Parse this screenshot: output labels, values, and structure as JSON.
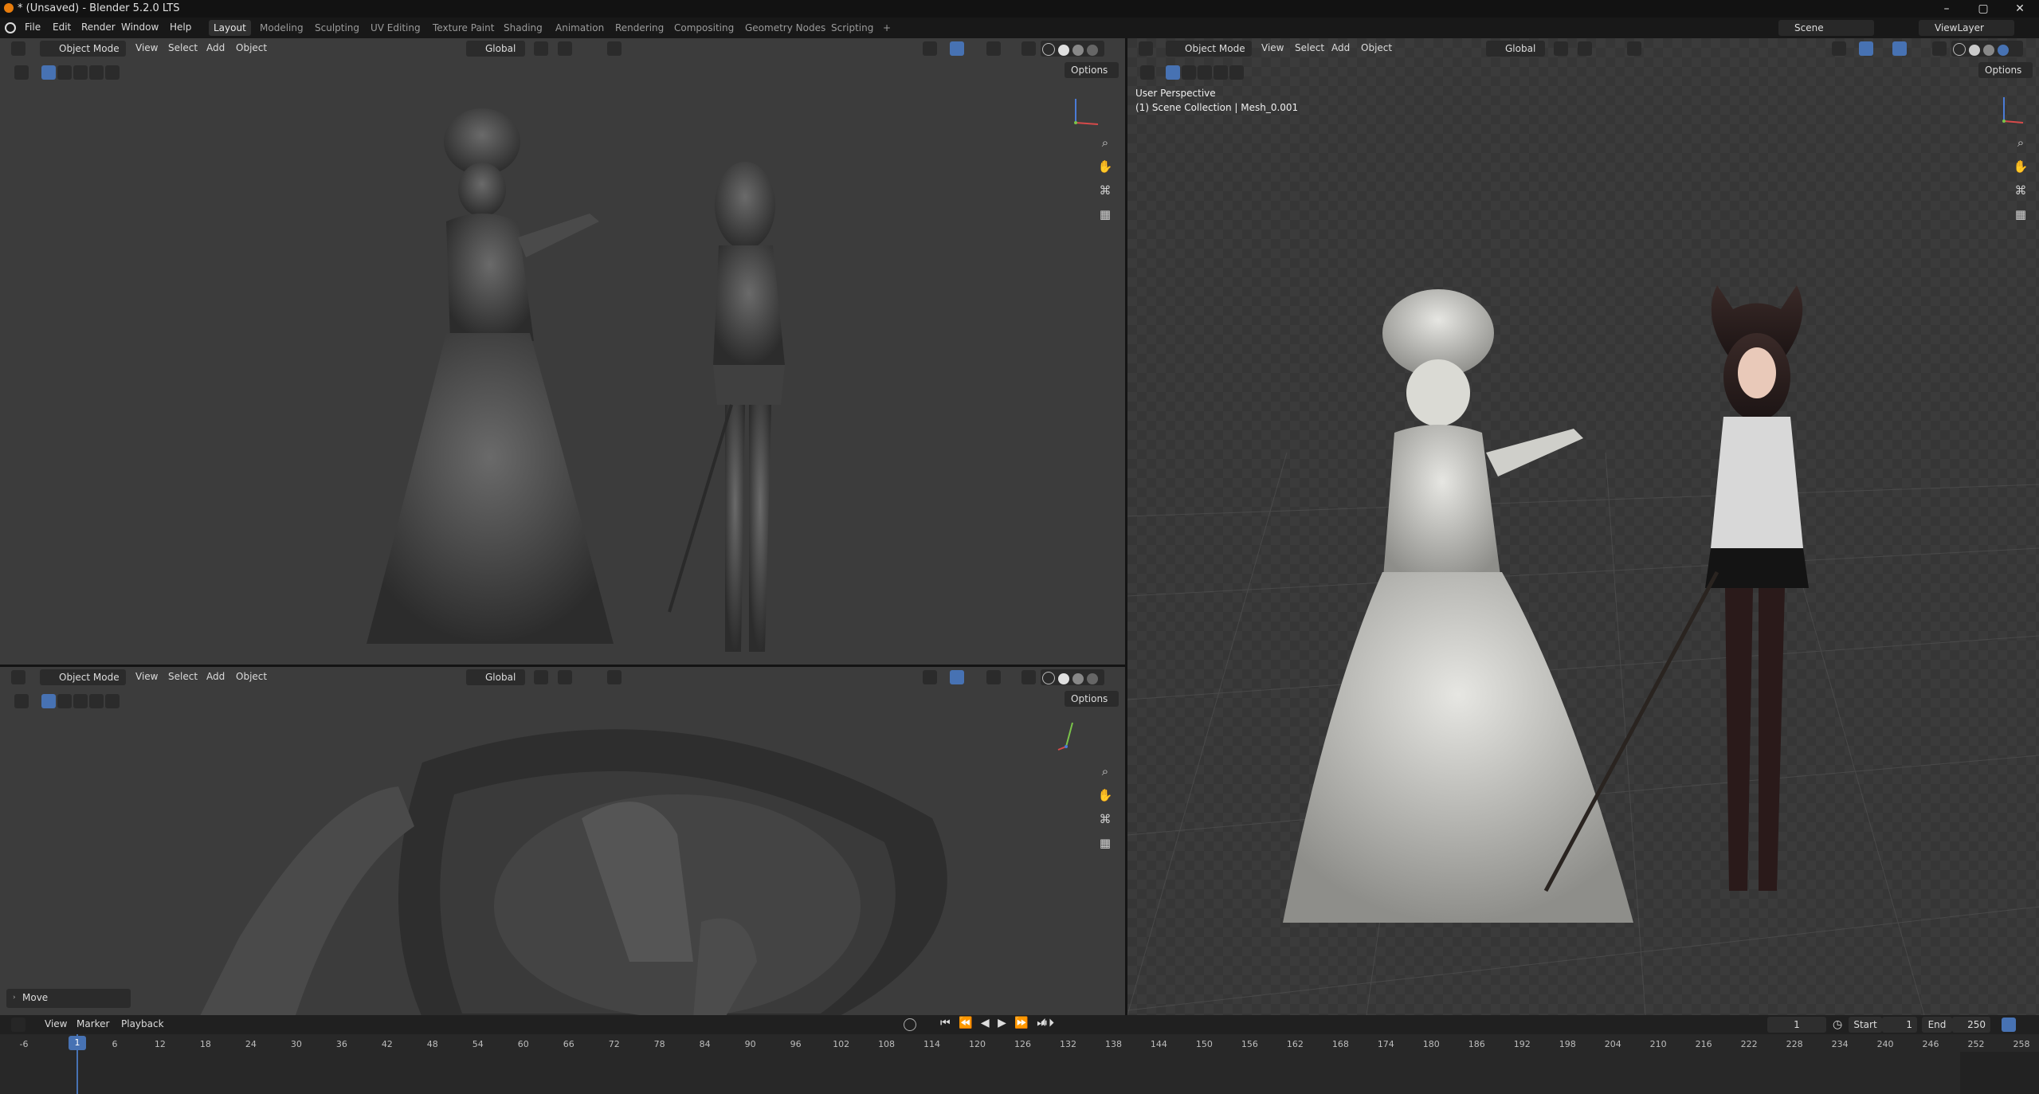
{
  "window": {
    "title": "* (Unsaved) - Blender 5.2.0 LTS",
    "controls": {
      "minimize": "–",
      "maximize": "▢",
      "close": "✕"
    }
  },
  "menu": [
    "File",
    "Edit",
    "Render",
    "Window",
    "Help"
  ],
  "workspaces": {
    "tabs": [
      "Layout",
      "Modeling",
      "Sculpting",
      "UV Editing",
      "Texture Paint",
      "Shading",
      "Animation",
      "Rendering",
      "Compositing",
      "Geometry Nodes",
      "Scripting"
    ],
    "active": "Layout",
    "add": "+"
  },
  "scene": {
    "label": "Scene",
    "view_layer": "ViewLayer"
  },
  "viewport_header": {
    "mode": "Object Mode",
    "menus": [
      "View",
      "Select",
      "Add",
      "Object"
    ],
    "orientation": "Global",
    "options": "Options"
  },
  "viewport_main": {
    "perspective": "User Perspective",
    "collection": "(1) Scene Collection | Mesh_0.001"
  },
  "viewport_bottom": {
    "operator_panel": "Move"
  },
  "timeline": {
    "menus": [
      "View",
      "Marker",
      "Playback"
    ],
    "current_frame": "1",
    "start_label": "Start",
    "start": "1",
    "end_label": "End",
    "end": "250",
    "ticks": [
      "-6",
      "1",
      "6",
      "12",
      "18",
      "24",
      "30",
      "36",
      "42",
      "48",
      "54",
      "60",
      "66",
      "72",
      "78",
      "84",
      "90",
      "96",
      "102",
      "108",
      "114",
      "120",
      "126",
      "132",
      "138",
      "144",
      "150",
      "156",
      "162",
      "168",
      "174",
      "180",
      "186",
      "192",
      "198",
      "204",
      "210",
      "216",
      "222",
      "228",
      "234",
      "240",
      "246",
      "252",
      "258"
    ],
    "playhead": "1"
  },
  "icons": [
    "blender-logo",
    "view3d-editor-icon",
    "object-mode-icon",
    "select-box-icon",
    "zoom-icon",
    "pan-hand-icon",
    "camera-icon",
    "grid-icon",
    "gizmo-icon",
    "shading-icon",
    "timeline-editor-icon",
    "play-icon"
  ],
  "colors": {
    "accent": "#4772b3",
    "brand": "#e87d0d"
  }
}
